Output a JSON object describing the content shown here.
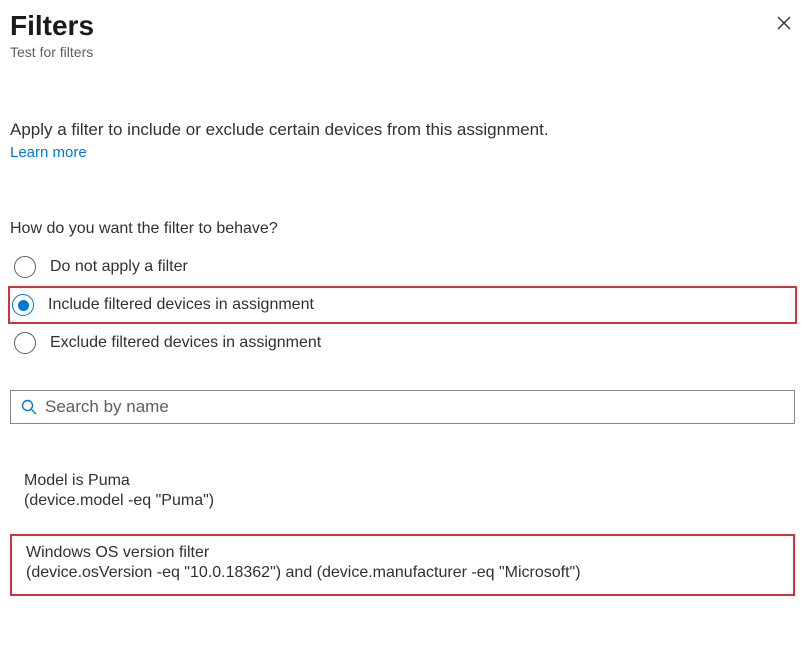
{
  "header": {
    "title": "Filters",
    "subtitle": "Test for filters"
  },
  "description": "Apply a filter to include or exclude certain devices from this assignment.",
  "learn_more": "Learn more",
  "question": "How do you want the filter to behave?",
  "radios": {
    "none": "Do not apply a filter",
    "include": "Include filtered devices in assignment",
    "exclude": "Exclude filtered devices in assignment"
  },
  "search": {
    "placeholder": "Search by name"
  },
  "filters": [
    {
      "name": "Model is Puma",
      "expr": "(device.model -eq \"Puma\")"
    },
    {
      "name": "Windows OS version filter",
      "expr": "(device.osVersion -eq \"10.0.18362\") and (device.manufacturer -eq \"Microsoft\")"
    }
  ]
}
